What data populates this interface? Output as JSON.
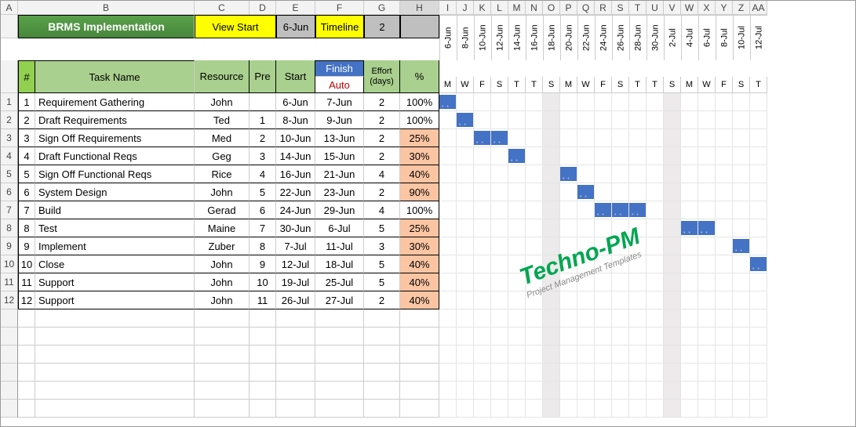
{
  "colHeaders": [
    "A",
    "B",
    "C",
    "D",
    "E",
    "F",
    "G",
    "H",
    "I",
    "J",
    "K",
    "L",
    "M",
    "N",
    "O",
    "P",
    "Q",
    "R",
    "S",
    "T",
    "U",
    "V",
    "W",
    "X",
    "Y",
    "Z",
    "AA"
  ],
  "selectedCol": "H",
  "header": {
    "title": "BRMS Implementation",
    "viewStart": "View Start",
    "viewDate": "6-Jun",
    "timeline": "Timeline",
    "timelineVal": "2",
    "cols": {
      "num": "#",
      "task": "Task Name",
      "resource": "Resource",
      "pre": "Pre",
      "start": "Start",
      "finish": "Finish",
      "auto": "Auto",
      "effort": "Effort (days)",
      "pct": "%"
    }
  },
  "gantt": {
    "dates": [
      "6-Jun",
      "8-Jun",
      "10-Jun",
      "12-Jun",
      "14-Jun",
      "16-Jun",
      "18-Jun",
      "20-Jun",
      "22-Jun",
      "24-Jun",
      "26-Jun",
      "28-Jun",
      "30-Jun",
      "2-Jul",
      "4-Jul",
      "6-Jul",
      "8-Jul",
      "10-Jul",
      "12-Jul"
    ],
    "days": [
      "M",
      "W",
      "F",
      "S",
      "T",
      "T",
      "S",
      "M",
      "W",
      "F",
      "S",
      "T",
      "T",
      "S",
      "M",
      "W",
      "F",
      "S",
      "T"
    ],
    "weekendIdx": [
      6,
      13
    ]
  },
  "tasks": [
    {
      "n": 1,
      "name": "Requirement Gathering",
      "res": "John",
      "pre": "",
      "start": "6-Jun",
      "finish": "7-Jun",
      "eff": "2",
      "pct": "100%",
      "barStart": 0,
      "barLen": 1,
      "partial": false
    },
    {
      "n": 2,
      "name": "Draft  Requirements",
      "res": "Ted",
      "pre": "1",
      "start": "8-Jun",
      "finish": "9-Jun",
      "eff": "2",
      "pct": "100%",
      "barStart": 1,
      "barLen": 1,
      "partial": false
    },
    {
      "n": 3,
      "name": "Sign Off  Requirements",
      "res": "Med",
      "pre": "2",
      "start": "10-Jun",
      "finish": "13-Jun",
      "eff": "2",
      "pct": "25%",
      "barStart": 2,
      "barLen": 2,
      "partial": true
    },
    {
      "n": 4,
      "name": "Draft Functional Reqs",
      "res": "Geg",
      "pre": "3",
      "start": "14-Jun",
      "finish": "15-Jun",
      "eff": "2",
      "pct": "30%",
      "barStart": 4,
      "barLen": 1,
      "partial": true
    },
    {
      "n": 5,
      "name": "Sign Off Functional Reqs",
      "res": "Rice",
      "pre": "4",
      "start": "16-Jun",
      "finish": "21-Jun",
      "eff": "4",
      "pct": "40%",
      "barStart": 7,
      "barLen": 1,
      "partial": true
    },
    {
      "n": 6,
      "name": "System Design",
      "res": "John",
      "pre": "5",
      "start": "22-Jun",
      "finish": "23-Jun",
      "eff": "2",
      "pct": "90%",
      "barStart": 8,
      "barLen": 1,
      "partial": true
    },
    {
      "n": 7,
      "name": "Build",
      "res": "Gerad",
      "pre": "6",
      "start": "24-Jun",
      "finish": "29-Jun",
      "eff": "4",
      "pct": "100%",
      "barStart": 9,
      "barLen": 3,
      "partial": false
    },
    {
      "n": 8,
      "name": "Test",
      "res": "Maine",
      "pre": "7",
      "start": "30-Jun",
      "finish": "6-Jul",
      "eff": "5",
      "pct": "25%",
      "barStart": 14,
      "barLen": 2,
      "partial": true
    },
    {
      "n": 9,
      "name": "Implement",
      "res": "Zuber",
      "pre": "8",
      "start": "7-Jul",
      "finish": "11-Jul",
      "eff": "3",
      "pct": "30%",
      "barStart": 17,
      "barLen": 1,
      "partial": true
    },
    {
      "n": 10,
      "name": "Close",
      "res": "John",
      "pre": "9",
      "start": "12-Jul",
      "finish": "18-Jul",
      "eff": "5",
      "pct": "40%",
      "barStart": 18,
      "barLen": 1,
      "partial": true
    },
    {
      "n": 11,
      "name": "Support",
      "res": "John",
      "pre": "10",
      "start": "19-Jul",
      "finish": "25-Jul",
      "eff": "5",
      "pct": "40%",
      "barStart": -1,
      "barLen": 0,
      "partial": true
    },
    {
      "n": 12,
      "name": "Support",
      "res": "John",
      "pre": "11",
      "start": "26-Jul",
      "finish": "27-Jul",
      "eff": "2",
      "pct": "40%",
      "barStart": -1,
      "barLen": 0,
      "partial": true
    }
  ],
  "watermark": {
    "line1": "Techno-PM",
    "line2": "Project Management Templates"
  },
  "chart_data": {
    "type": "table",
    "title": "BRMS Implementation — Gantt Schedule",
    "columns": [
      "#",
      "Task Name",
      "Resource",
      "Pre",
      "Start",
      "Finish",
      "Effort (days)",
      "%"
    ],
    "rows": [
      [
        1,
        "Requirement Gathering",
        "John",
        "",
        "6-Jun",
        "7-Jun",
        2,
        "100%"
      ],
      [
        2,
        "Draft Requirements",
        "Ted",
        1,
        "8-Jun",
        "9-Jun",
        2,
        "100%"
      ],
      [
        3,
        "Sign Off Requirements",
        "Med",
        2,
        "10-Jun",
        "13-Jun",
        2,
        "25%"
      ],
      [
        4,
        "Draft Functional Reqs",
        "Geg",
        3,
        "14-Jun",
        "15-Jun",
        2,
        "30%"
      ],
      [
        5,
        "Sign Off Functional Reqs",
        "Rice",
        4,
        "16-Jun",
        "21-Jun",
        4,
        "40%"
      ],
      [
        6,
        "System Design",
        "John",
        5,
        "22-Jun",
        "23-Jun",
        2,
        "90%"
      ],
      [
        7,
        "Build",
        "Gerad",
        6,
        "24-Jun",
        "29-Jun",
        4,
        "100%"
      ],
      [
        8,
        "Test",
        "Maine",
        7,
        "30-Jun",
        "6-Jul",
        5,
        "25%"
      ],
      [
        9,
        "Implement",
        "Zuber",
        8,
        "7-Jul",
        "11-Jul",
        3,
        "30%"
      ],
      [
        10,
        "Close",
        "John",
        9,
        "12-Jul",
        "18-Jul",
        5,
        "40%"
      ],
      [
        11,
        "Support",
        "John",
        10,
        "19-Jul",
        "25-Jul",
        5,
        "40%"
      ],
      [
        12,
        "Support",
        "John",
        11,
        "26-Jul",
        "27-Jul",
        2,
        "40%"
      ]
    ],
    "timeline_start": "6-Jun",
    "timeline_step_days": 2,
    "timeline_cols": 19
  }
}
